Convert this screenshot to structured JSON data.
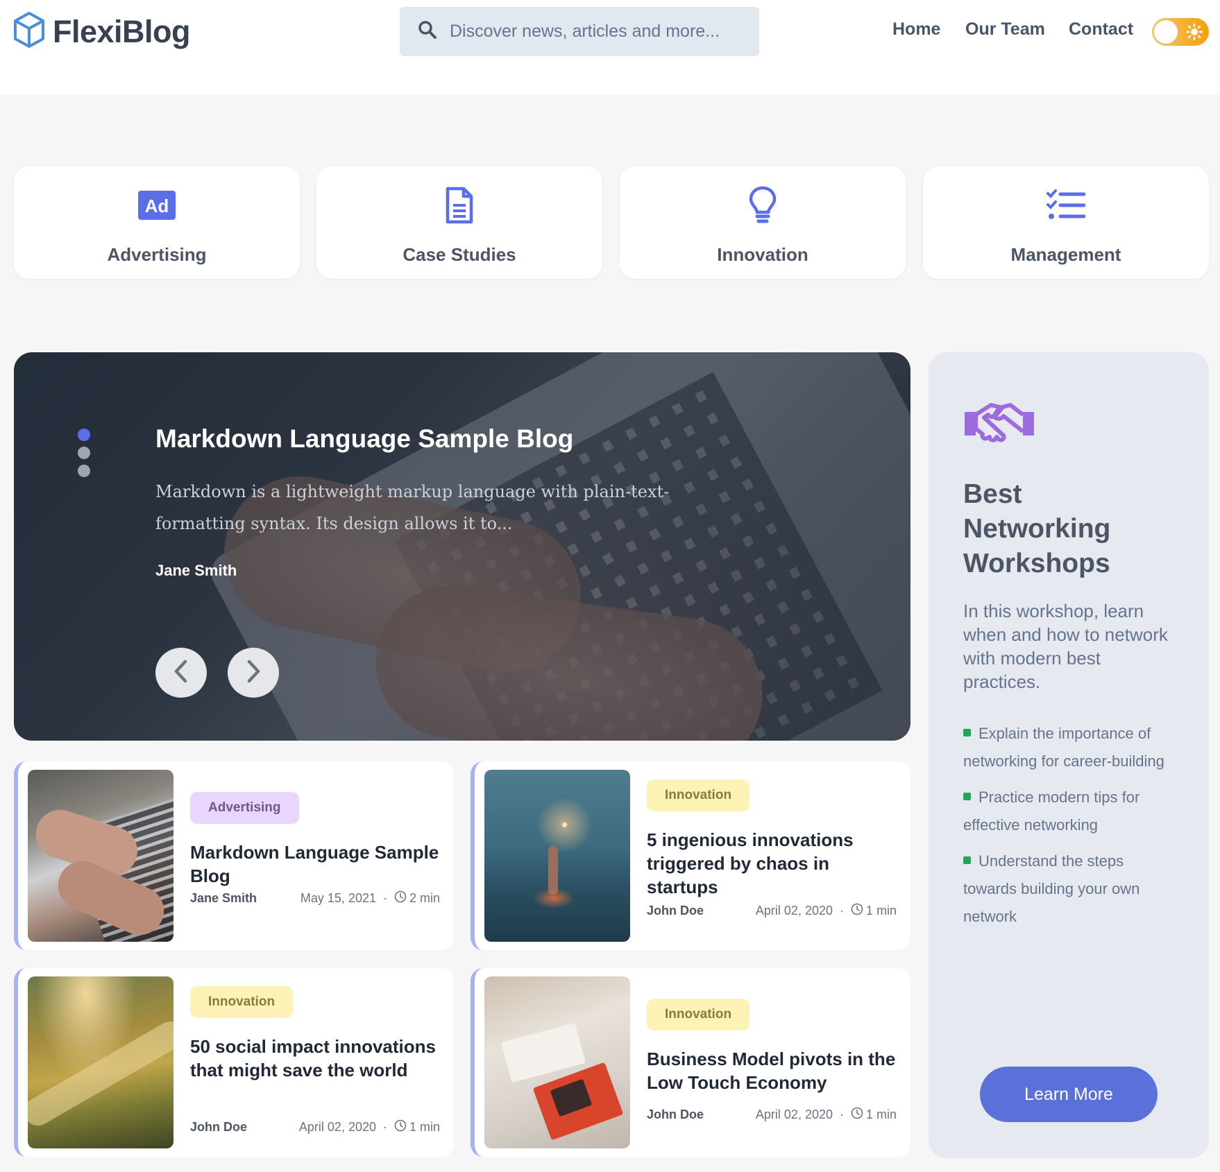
{
  "header": {
    "logo_text": "FlexiBlog",
    "search_placeholder": "Discover news, articles and more...",
    "nav": [
      "Home",
      "Our Team",
      "Contact"
    ]
  },
  "categories": [
    {
      "label": "Advertising",
      "icon": "ad-icon"
    },
    {
      "label": "Case Studies",
      "icon": "document-icon"
    },
    {
      "label": "Innovation",
      "icon": "lightbulb-icon"
    },
    {
      "label": "Management",
      "icon": "checklist-icon"
    }
  ],
  "hero": {
    "title": "Markdown Language Sample Blog",
    "excerpt": "Markdown is a lightweight markup language with plain-text-formatting syntax. Its design allows it to...",
    "author": "Jane Smith",
    "slide_count": 3,
    "active_slide": 1
  },
  "posts": [
    {
      "tag": "Advertising",
      "title": "Markdown Language Sample Blog",
      "author": "Jane Smith",
      "date": "May 15, 2021",
      "read": "2 min"
    },
    {
      "tag": "Innovation",
      "title": "5 ingenious innovations triggered by chaos in startups",
      "author": "John Doe",
      "date": "April 02, 2020",
      "read": "1 min"
    },
    {
      "tag": "Innovation",
      "title": "50 social impact innovations that might save the world",
      "author": "John Doe",
      "date": "April 02, 2020",
      "read": "1 min"
    },
    {
      "tag": "Innovation",
      "title": "Business Model pivots in the Low Touch Economy",
      "author": "John Doe",
      "date": "April 02, 2020",
      "read": "1 min"
    }
  ],
  "sidebar": {
    "icon": "handshake-icon",
    "title": "Best Networking Workshops",
    "description": "In this workshop, learn when and how to network with modern best practices.",
    "bullets": [
      "Explain the importance of networking for career-building",
      "Practice modern tips for effective networking",
      "Understand the steps towards building your own network"
    ],
    "button": "Learn More"
  },
  "colors": {
    "accent": "#5a71d9",
    "icon": "#5b6ee8",
    "tag_purple": "#e9d5ff",
    "tag_yellow": "#fdf3b7",
    "bullet": "#22a559",
    "toggle": "#f59e0b"
  }
}
